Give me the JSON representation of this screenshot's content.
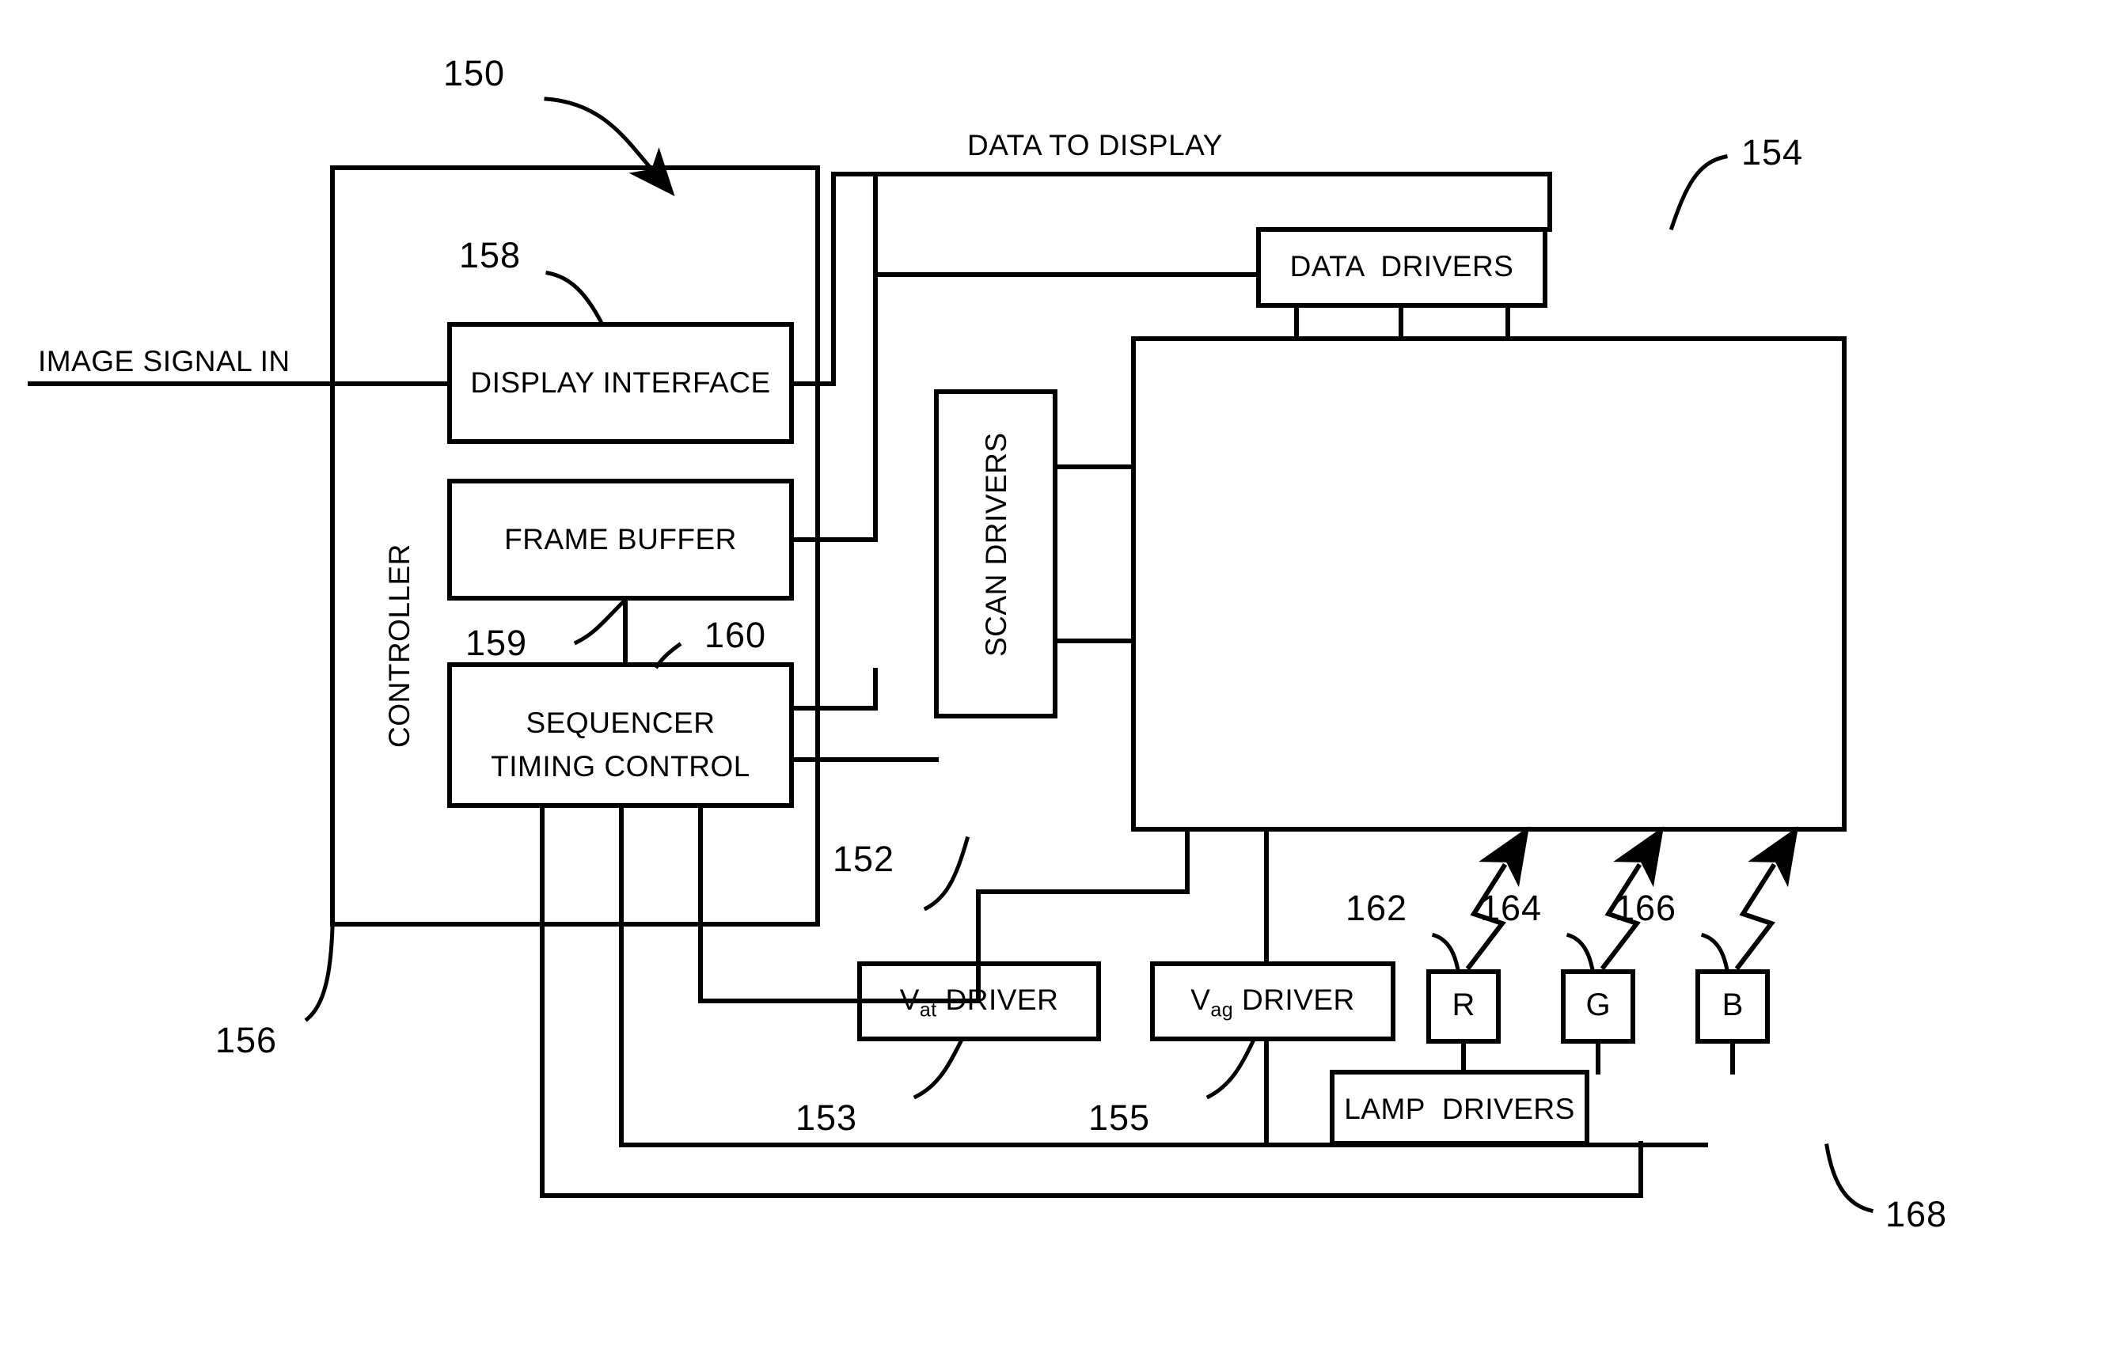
{
  "figure": {
    "title_ref": "150",
    "signal_in": "IMAGE SIGNAL IN",
    "data_to_display": "DATA TO DISPLAY"
  },
  "blocks": {
    "controller": {
      "label": "CONTROLLER",
      "ref": "156"
    },
    "display_interface": {
      "label": "DISPLAY INTERFACE",
      "ref": "158"
    },
    "frame_buffer": {
      "label": "FRAME BUFFER",
      "ref": "159"
    },
    "sequencer": {
      "label_line1": "SEQUENCER",
      "label_line2": "TIMING CONTROL",
      "ref": "160"
    },
    "scan_drivers": {
      "label": "SCAN DRIVERS",
      "ref": "152"
    },
    "data_drivers": {
      "label": "DATA  DRIVERS",
      "ref": "154"
    },
    "display_panel": {
      "label": ""
    },
    "vat_driver": {
      "label_main": "V",
      "label_sub": "at",
      "label_tail": " DRIVER",
      "ref": "153"
    },
    "vag_driver": {
      "label_main": "V",
      "label_sub": "ag",
      "label_tail": " DRIVER",
      "ref": "155"
    },
    "lamp_drivers": {
      "label": "LAMP  DRIVERS",
      "ref": "168"
    },
    "lamp_r": {
      "label": "R",
      "ref": "162"
    },
    "lamp_g": {
      "label": "G",
      "ref": "164"
    },
    "lamp_b": {
      "label": "B",
      "ref": "166"
    }
  },
  "colors": {
    "ink": "#000000",
    "paper": "#ffffff"
  }
}
